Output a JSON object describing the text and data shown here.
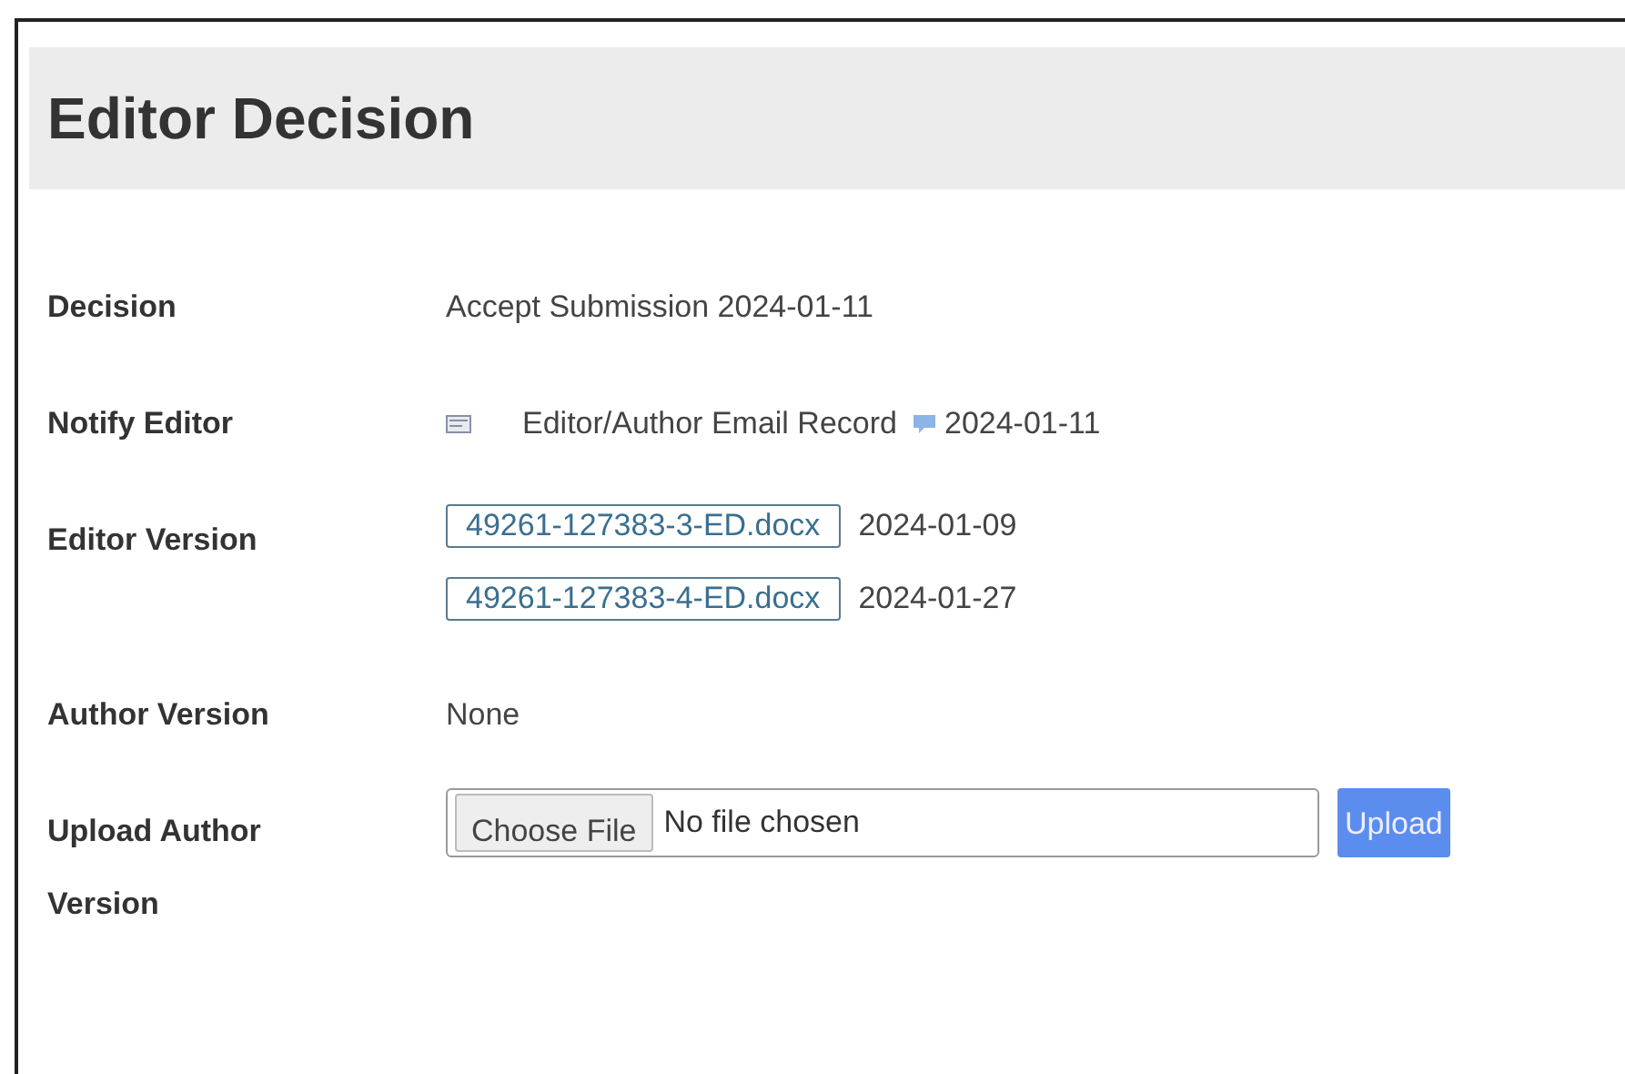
{
  "heading": "Editor Decision",
  "rows": [
    {
      "kind": "text",
      "label": "Decision",
      "text": "Accept Submission 2024-01-11"
    },
    {
      "kind": "notify",
      "label": "Notify Editor",
      "link": "Editor/Author Email Record",
      "date": "2024-01-11"
    },
    {
      "kind": "files",
      "label": "Editor Version",
      "files": [
        {
          "name": "49261-127383-3-ED.docx",
          "date": "2024-01-09"
        },
        {
          "name": "49261-127383-4-ED.docx",
          "date": "2024-01-27"
        }
      ]
    },
    {
      "kind": "text",
      "label": "Author Version",
      "text": "None"
    },
    {
      "kind": "upload",
      "label": "Upload Author Version",
      "choose": "Choose File",
      "status": "No file chosen",
      "button": "Upload"
    }
  ]
}
